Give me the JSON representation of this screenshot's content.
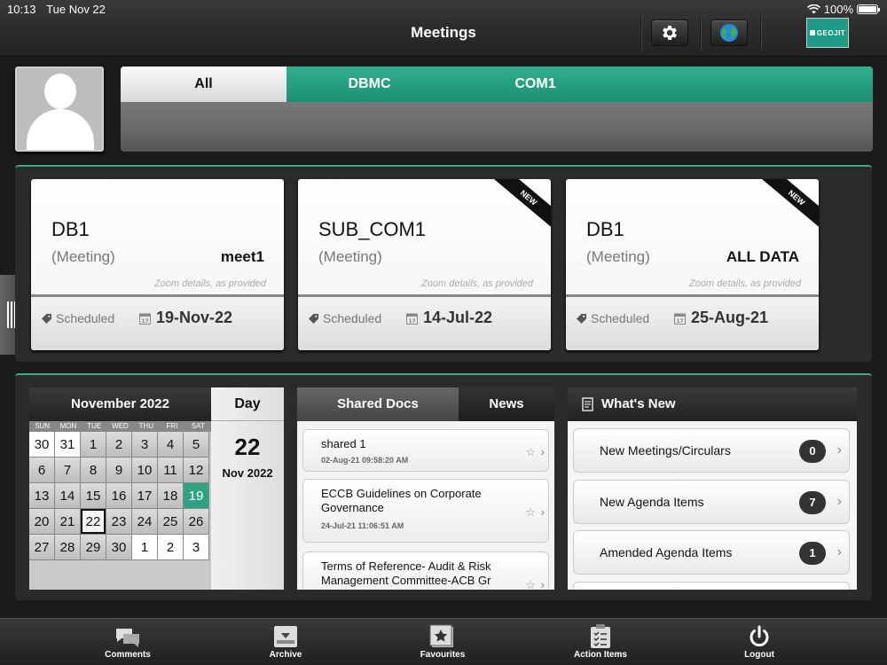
{
  "status": {
    "time": "10:13",
    "date": "Tue Nov 22",
    "battery": "100%"
  },
  "header": {
    "title": "Meetings",
    "logo_text": "GEOJIT"
  },
  "tabs": [
    {
      "label": "All"
    },
    {
      "label": "DBMC"
    },
    {
      "label": "COM1"
    }
  ],
  "meetings": [
    {
      "name": "DB1",
      "type": "(Meeting)",
      "meta": "meet1",
      "zoom": "Zoom details, as provided",
      "status": "Scheduled",
      "date": "19-Nov-22",
      "is_new": false
    },
    {
      "name": "SUB_COM1",
      "type": "(Meeting)",
      "meta": "",
      "zoom": "Zoom details, as provided",
      "status": "Scheduled",
      "date": "14-Jul-22",
      "is_new": true,
      "ribbon": "NEW"
    },
    {
      "name": "DB1",
      "type": "(Meeting)",
      "meta": "ALL DATA",
      "zoom": "Zoom details, as provided",
      "status": "Scheduled",
      "date": "25-Aug-21",
      "is_new": true,
      "ribbon": "NEW"
    }
  ],
  "calendar": {
    "month": "November 2022",
    "weekdays": [
      "SUN",
      "MON",
      "TUE",
      "WED",
      "THU",
      "FRI",
      "SAT"
    ],
    "days": [
      "30",
      "31",
      "1",
      "2",
      "3",
      "4",
      "5",
      "6",
      "7",
      "8",
      "9",
      "10",
      "11",
      "12",
      "13",
      "14",
      "15",
      "16",
      "17",
      "18",
      "19",
      "20",
      "21",
      "22",
      "23",
      "24",
      "25",
      "26",
      "27",
      "28",
      "29",
      "30",
      "1",
      "2",
      "3"
    ],
    "today": "19",
    "selected": "22"
  },
  "day_view": {
    "label": "Day",
    "day": "22",
    "month_year": "Nov 2022"
  },
  "docs": {
    "tab_shared": "Shared Docs",
    "tab_news": "News",
    "items": [
      {
        "title": "shared 1",
        "date": "02-Aug-21 09:58:20 AM"
      },
      {
        "title": "ECCB Guidelines on Corporate Governance",
        "date": "24-Jul-21 11:06:51 AM"
      },
      {
        "title": "Terms of Reference- Audit & Risk Management Committee-ACB Gr",
        "date": ""
      }
    ]
  },
  "whats_new": {
    "title": "What's New",
    "items": [
      {
        "label": "New Meetings/Circulars",
        "count": "0"
      },
      {
        "label": "New Agenda Items",
        "count": "7"
      },
      {
        "label": "Amended Agenda Items",
        "count": "1"
      }
    ]
  },
  "tabbar": [
    {
      "label": "Comments",
      "icon": "comments-icon"
    },
    {
      "label": "Archive",
      "icon": "archive-icon"
    },
    {
      "label": "Favourites",
      "icon": "favourites-icon"
    },
    {
      "label": "Action Items",
      "icon": "action-items-icon"
    },
    {
      "label": "Logout",
      "icon": "logout-icon"
    }
  ],
  "colors": {
    "accent": "#2ea283",
    "dark": "#2b2b2b"
  }
}
